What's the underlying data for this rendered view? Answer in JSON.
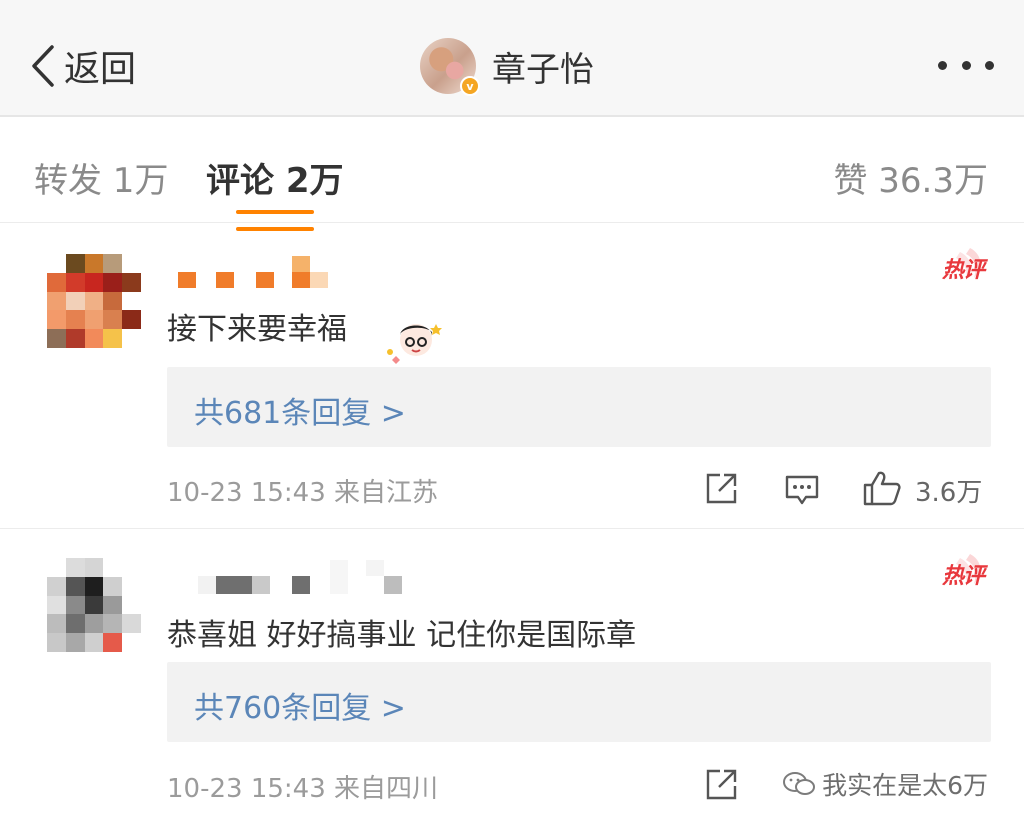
{
  "nav": {
    "back_label": "返回",
    "username": "章子怡",
    "verified_badge": "v"
  },
  "tabs": {
    "repost": "转发 1万",
    "comment": "评论 2万",
    "like": "赞 36.3万",
    "active_color": "#ff8200"
  },
  "comments": [
    {
      "hot_label": "热评",
      "text": "接下来要幸福",
      "replies_label": "共681条回复 >",
      "meta": "10-23 15:43  来自江苏",
      "likes": "3.6万"
    },
    {
      "hot_label": "热评",
      "text": "恭喜姐 好好搞事业 记住你是国际章",
      "replies_label": "共760条回复 >",
      "meta": "10-23 15:43  来自四川",
      "watermark": "我实在是太6万"
    }
  ],
  "colors": {
    "link": "#5b86b8",
    "hot": "#e8383d",
    "meta": "#9b9b9b"
  },
  "icons": [
    "chevron-left-icon",
    "more-icon",
    "share-icon",
    "reply-icon",
    "like-icon",
    "wechat-icon"
  ]
}
